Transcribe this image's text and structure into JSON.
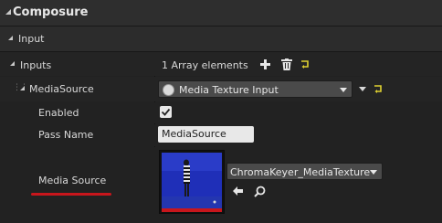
{
  "category": {
    "title": "Composure"
  },
  "subcategory": {
    "title": "Input"
  },
  "inputs": {
    "label": "Inputs",
    "count_text": "1 Array elements"
  },
  "media_source_element": {
    "label": "MediaSource",
    "dropdown_value": "Media Texture Input"
  },
  "enabled": {
    "label": "Enabled",
    "checked": true
  },
  "pass_name": {
    "label": "Pass Name",
    "value": "MediaSource"
  },
  "media_source": {
    "label": "Media Source",
    "asset_value": "ChromaKeyer_MediaTexture"
  },
  "colors": {
    "accent_red": "#c8161c",
    "reset_yellow": "#e0d231",
    "thumbnail_blue": "#1f2fb8"
  }
}
